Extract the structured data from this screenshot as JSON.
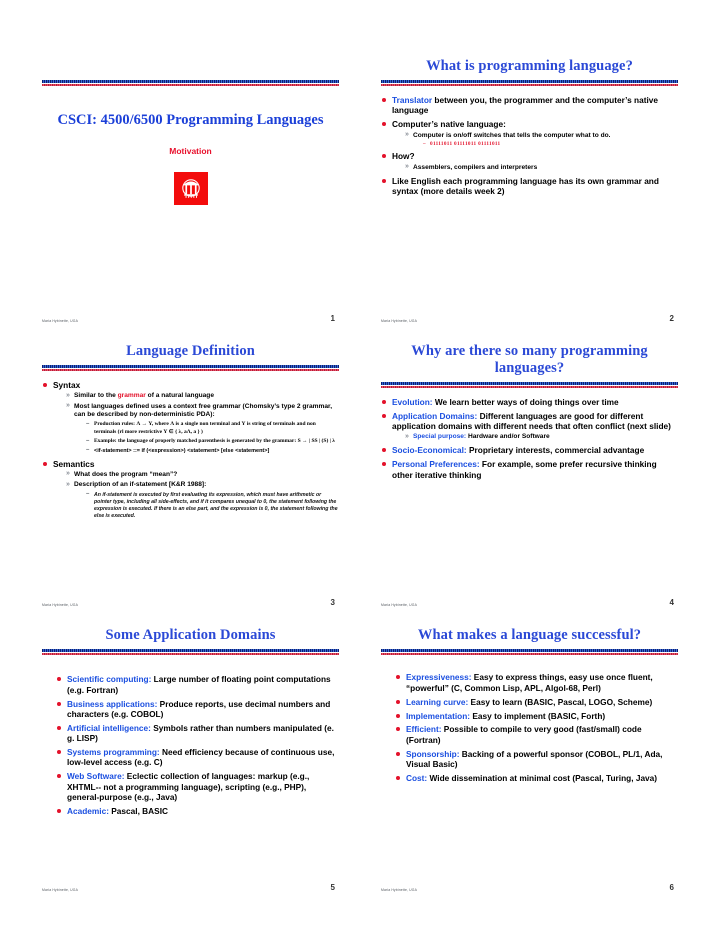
{
  "document": {
    "credit": "Maria Hybinette, UGA",
    "slide_title_color": "#2B49D6",
    "accent_red": "#E3122B",
    "accent_blue": "#1B4FE0"
  },
  "slides": [
    {
      "number": "1",
      "kind": "title",
      "course_title": "CSCI: 4500/6500 Programming Languages",
      "subtitle": "Motivation",
      "logo_name": "uga-arch-logo",
      "credit": "Maria Hybinette, UGA"
    },
    {
      "number": "2",
      "kind": "bullets",
      "title": "What is programming language?",
      "credit": "Maria Hybinette, UGA",
      "bullets": [
        {
          "level": 1,
          "keyword": "Translator",
          "keyword_color": "blue",
          "text": " between you, the programmer and the computer’s native language"
        },
        {
          "level": 1,
          "text": "Computer’s native language:"
        },
        {
          "level": 2,
          "text": "Computer is on/off switches that tells the computer what to do."
        },
        {
          "level": 4,
          "text": "01111011  01111011  01111011"
        },
        {
          "level": 1,
          "text": "How?"
        },
        {
          "level": 2,
          "text": "Assemblers, compilers and interpreters"
        },
        {
          "level": 1,
          "text": "Like English each programming language has its own grammar and syntax (more details week 2)"
        }
      ]
    },
    {
      "number": "3",
      "kind": "bullets",
      "title": "Language Definition",
      "credit": "Maria Hybinette, UGA",
      "bullets": [
        {
          "level": 1,
          "text": "Syntax"
        },
        {
          "level": 2,
          "text_before": "Similar to the ",
          "keyword": "grammar",
          "keyword_color": "red",
          "text_after": " of a natural language"
        },
        {
          "level": 2,
          "text": "Most languages defined uses a context free grammar (Chomsky’s type 2 grammar, can be described by non-deterministic PDA):"
        },
        {
          "level": 3,
          "text": "Production rules:  Λ → Υ, where Λ is a single non terminal and Υ is string of terminals and non terminals (rl more restrictive Υ ∈ { λ, aΛ, a } )",
          "italic_word": "single"
        },
        {
          "level": 3,
          "text": "Example: the language of properly matched parenthesis is generated by the grammar: S → | SS | (S) | λ"
        },
        {
          "level": 3,
          "text": "<if-statement> ::= if (<expression>)  <statement> [else <statement>]"
        },
        {
          "level": 1,
          "text": "Semantics"
        },
        {
          "level": 2,
          "text": "What does the program “mean”?"
        },
        {
          "level": 2,
          "text": "Description of an if-statement [K&R 1988]:"
        },
        {
          "level": 3,
          "italic": true,
          "text": "An if-statement is executed by first evaluating its expression, which must have arithmetic or pointer type, including all side-effects, and if it compares unequal to 0, the statement following the expression is executed.  If there is an else part, and the expression is 0, the statement following the else is executed."
        }
      ]
    },
    {
      "number": "4",
      "kind": "bullets",
      "title": "Why are there so many programming languages?",
      "credit": "Maria Hybinette, UGA",
      "bullets": [
        {
          "level": 1,
          "keyword": "Evolution:",
          "keyword_color": "blue",
          "text": " We learn better ways of doing things over time"
        },
        {
          "level": 1,
          "keyword": "Application Domains:",
          "keyword_color": "blue",
          "text": " Different languages are good for different application domains with different needs that often conflict (next slide)"
        },
        {
          "level": 2,
          "keyword": "Special purpose:",
          "keyword_color": "blue",
          "text": " Hardware and/or Software"
        },
        {
          "level": 1,
          "keyword": "Socio-Economical:",
          "keyword_color": "blue",
          "text": " Proprietary interests, commercial advantage"
        },
        {
          "level": 1,
          "keyword": "Personal Preferences:",
          "keyword_color": "blue",
          "text": " For example, some prefer recursive thinking other iterative thinking"
        }
      ]
    },
    {
      "number": "5",
      "kind": "bullets",
      "title": "Some Application Domains",
      "credit": "Maria Hybinette, UGA",
      "bullets": [
        {
          "level": 1,
          "keyword": "Scientific computing:",
          "keyword_color": "blue",
          "text": " Large number of floating point computations (e.g. Fortran)"
        },
        {
          "level": 1,
          "keyword": "Business applications:",
          "keyword_color": "blue",
          "text": "  Produce reports, use decimal numbers and characters (e.g. COBOL)"
        },
        {
          "level": 1,
          "keyword": "Artificial intelligence:",
          "keyword_color": "blue",
          "text": "  Symbols rather than numbers manipulated (e. g. LISP)"
        },
        {
          "level": 1,
          "keyword": "Systems programming:",
          "keyword_color": "blue",
          "text": "  Need efficiency because of continuous use, low-level access  (e.g. C)"
        },
        {
          "level": 1,
          "keyword": "Web Software:",
          "keyword_color": "blue",
          "text": "  Eclectic collection of languages: markup (e.g., XHTML-- not a programming language), scripting (e.g., PHP), general-purpose (e.g., Java)"
        },
        {
          "level": 1,
          "keyword": "Academic:",
          "keyword_color": "blue",
          "text": " Pascal, BASIC"
        }
      ]
    },
    {
      "number": "6",
      "kind": "bullets",
      "title": "What makes a language successful?",
      "credit": "Maria Hybinette, UGA",
      "bullets": [
        {
          "level": 1,
          "keyword": "Expressiveness:",
          "keyword_color": "blue",
          "text": " Easy to express things, easy use once fluent, “powerful” (C, Common Lisp, APL, Algol-68, Perl)"
        },
        {
          "level": 1,
          "keyword": "Learning curve:",
          "keyword_color": "blue",
          "text": " Easy to learn (BASIC, Pascal, LOGO, Scheme)"
        },
        {
          "level": 1,
          "keyword": "Implementation:",
          "keyword_color": "blue",
          "text": " Easy to implement (BASIC, Forth)"
        },
        {
          "level": 1,
          "keyword": "Efficient:",
          "keyword_color": "blue",
          "text": "  Possible to compile to very good (fast/small) code (Fortran)"
        },
        {
          "level": 1,
          "keyword": "Sponsorship:",
          "keyword_color": "blue",
          "text": "  Backing of a powerful sponsor (COBOL, PL/1, Ada, Visual Basic)"
        },
        {
          "level": 1,
          "keyword": "Cost:",
          "keyword_color": "blue",
          "text": "  Wide dissemination at minimal cost (Pascal, Turing, Java)"
        }
      ]
    }
  ]
}
